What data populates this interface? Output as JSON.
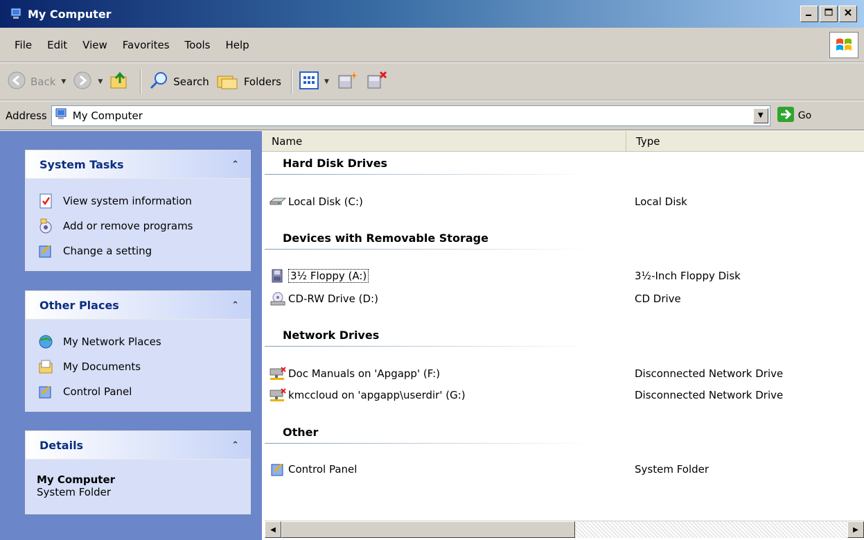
{
  "window": {
    "title": "My Computer"
  },
  "menu": [
    {
      "label": "File"
    },
    {
      "label": "Edit"
    },
    {
      "label": "View"
    },
    {
      "label": "Favorites"
    },
    {
      "label": "Tools"
    },
    {
      "label": "Help"
    }
  ],
  "toolbar": {
    "back_label": "Back",
    "search_label": "Search",
    "folders_label": "Folders"
  },
  "address": {
    "label": "Address",
    "value": "My Computer",
    "go_label": "Go"
  },
  "sidebar": {
    "system_tasks": {
      "title": "System Tasks",
      "items": [
        {
          "label": "View system information",
          "icon": "system-info-icon"
        },
        {
          "label": "Add or remove programs",
          "icon": "add-remove-programs-icon"
        },
        {
          "label": "Change a setting",
          "icon": "control-panel-icon"
        }
      ]
    },
    "other_places": {
      "title": "Other Places",
      "items": [
        {
          "label": "My Network Places",
          "icon": "network-places-icon"
        },
        {
          "label": "My Documents",
          "icon": "documents-folder-icon"
        },
        {
          "label": "Control Panel",
          "icon": "control-panel-icon"
        }
      ]
    },
    "details": {
      "title": "Details",
      "name": "My Computer",
      "type": "System Folder"
    }
  },
  "list": {
    "columns": [
      "Name",
      "Type"
    ],
    "groups": [
      {
        "title": "Hard Disk Drives",
        "items": [
          {
            "name": "Local Disk (C:)",
            "type": "Local Disk",
            "icon": "hard-disk-icon"
          }
        ]
      },
      {
        "title": "Devices with Removable Storage",
        "items": [
          {
            "name": "3½ Floppy (A:)",
            "type": "3½-Inch Floppy Disk",
            "icon": "floppy-drive-icon"
          },
          {
            "name": "CD-RW Drive (D:)",
            "type": "CD Drive",
            "icon": "cd-drive-icon"
          }
        ]
      },
      {
        "title": "Network Drives",
        "items": [
          {
            "name": "Doc Manuals on 'Apgapp' (F:)",
            "type": "Disconnected Network Drive",
            "icon": "network-drive-disconnected-icon"
          },
          {
            "name": "kmccloud on 'apgapp\\userdir' (G:)",
            "type": "Disconnected Network Drive",
            "icon": "network-drive-disconnected-icon"
          }
        ]
      },
      {
        "title": "Other",
        "items": [
          {
            "name": "Control Panel",
            "type": "System Folder",
            "icon": "control-panel-icon"
          }
        ]
      }
    ]
  },
  "colors": {
    "sidebar_bg": "#6b86c9",
    "panel_title": "#0b2e82",
    "chrome": "#d4d0c8"
  }
}
